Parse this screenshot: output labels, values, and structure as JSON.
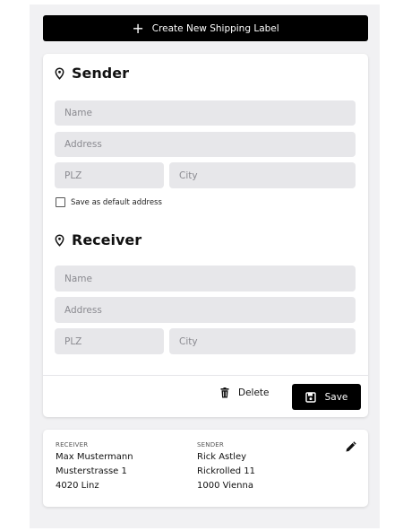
{
  "create_button": {
    "label": "Create New Shipping Label",
    "icon": "plus-icon"
  },
  "sender": {
    "title": "Sender",
    "name_placeholder": "Name",
    "address_placeholder": "Address",
    "plz_placeholder": "PLZ",
    "city_placeholder": "City",
    "default_checkbox_label": "Save as default address",
    "default_checked": false
  },
  "receiver": {
    "title": "Receiver",
    "name_placeholder": "Name",
    "address_placeholder": "Address",
    "plz_placeholder": "PLZ",
    "city_placeholder": "City"
  },
  "actions": {
    "delete_label": "Delete",
    "save_label": "Save"
  },
  "summary": {
    "receiver": {
      "label": "RECEIVER",
      "name": "Max Mustermann",
      "street": "Musterstrasse 1",
      "city": "4020 Linz"
    },
    "sender": {
      "label": "SENDER",
      "name": "Rick Astley",
      "street": "Rickrolled 11",
      "city": "1000 Vienna"
    },
    "edit_icon": "pencil-icon"
  },
  "colors": {
    "primary": "#000000",
    "field_bg": "#e7e7ea",
    "page_bg": "#f1f1f3"
  }
}
